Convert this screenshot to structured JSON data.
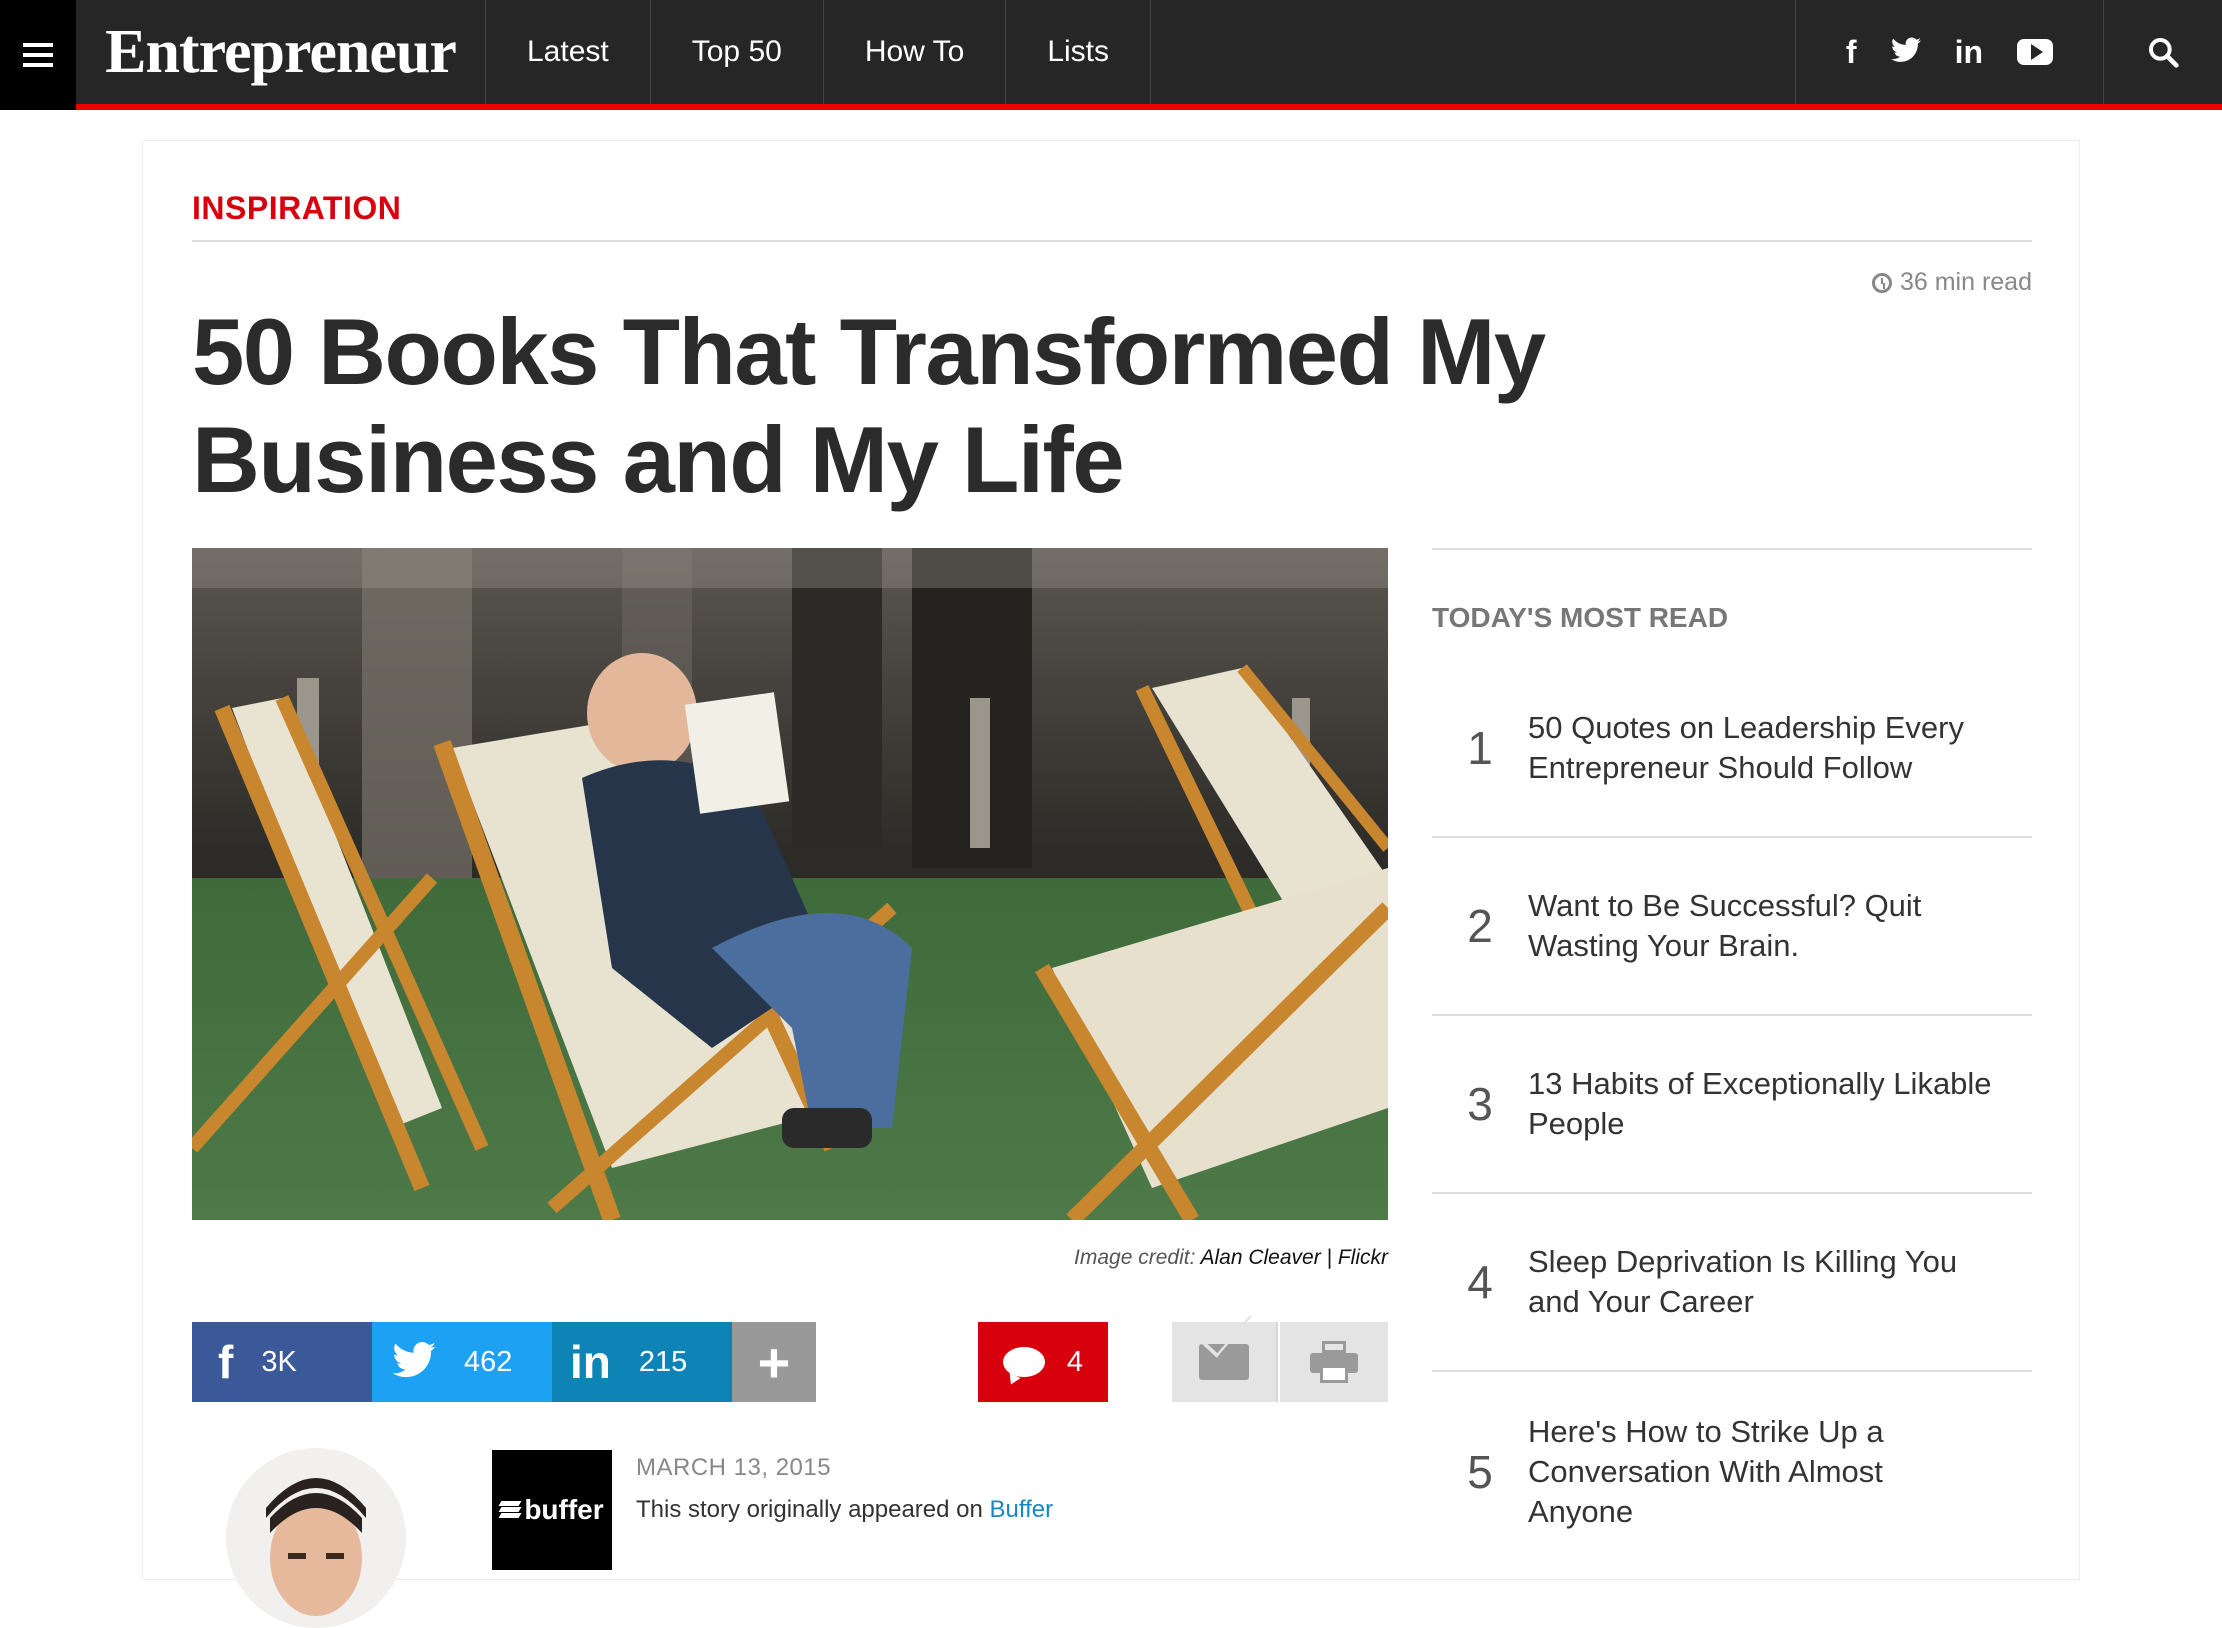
{
  "nav": {
    "logo": "Entrepreneur",
    "items": [
      {
        "label": "Latest"
      },
      {
        "label": "Top 50"
      },
      {
        "label": "How To"
      },
      {
        "label": "Lists"
      }
    ],
    "social_icons": [
      "facebook-icon",
      "twitter-icon",
      "linkedin-icon",
      "youtube-icon"
    ],
    "accent_color": "#e60000"
  },
  "article": {
    "section": "INSPIRATION",
    "read_time": "36 min read",
    "headline": "50 Books That Transformed My Business and My Life",
    "image_credit_prefix": "Image credit: ",
    "image_credit_name": "Alan Cleaver | Flickr",
    "date": "MARCH 13, 2015",
    "origin_text": "This story originally appeared on ",
    "origin_link": "Buffer",
    "source_logo": "buffer"
  },
  "share": {
    "facebook_count": "3K",
    "twitter_count": "462",
    "linkedin_count": "215",
    "comments_count": "4",
    "colors": {
      "facebook": "#3b5998",
      "twitter": "#1da1f2",
      "linkedin": "#0e83b5",
      "comments": "#d9000d"
    }
  },
  "sidebar": {
    "title": "TODAY'S MOST READ",
    "items": [
      {
        "num": "1",
        "title": "50 Quotes on Leadership Every Entrepreneur Should Follow"
      },
      {
        "num": "2",
        "title": "Want to Be Successful? Quit Wasting Your Brain."
      },
      {
        "num": "3",
        "title": "13 Habits of Exceptionally Likable People"
      },
      {
        "num": "4",
        "title": "Sleep Deprivation Is Killing You and Your Career"
      },
      {
        "num": "5",
        "title": "Here's How to Strike Up a Conversation With Almost Anyone"
      }
    ]
  }
}
